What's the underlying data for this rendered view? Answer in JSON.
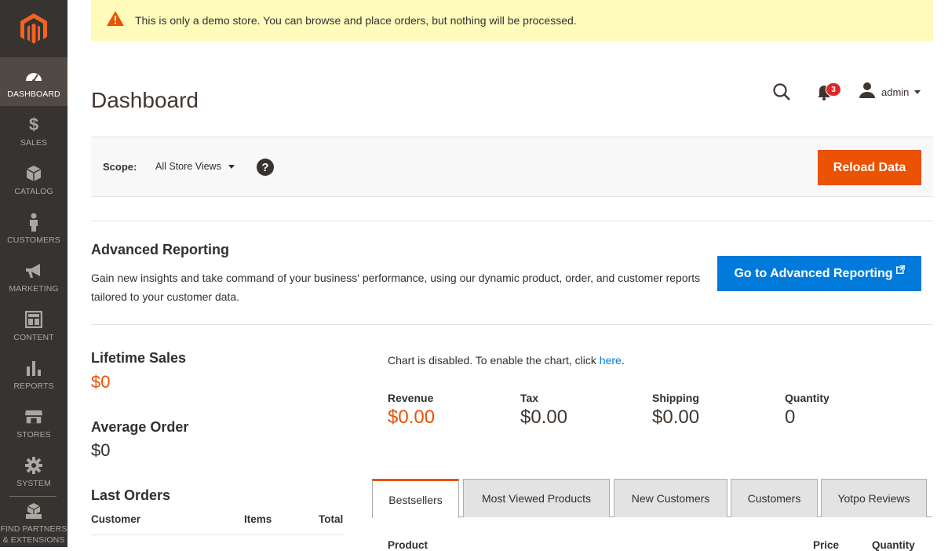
{
  "notice": {
    "text": "This is only a demo store. You can browse and place orders, but nothing will be processed."
  },
  "sidebar": {
    "items": [
      {
        "label": "DASHBOARD",
        "icon": "dashboard-icon",
        "active": true
      },
      {
        "label": "SALES",
        "icon": "dollar-icon"
      },
      {
        "label": "CATALOG",
        "icon": "box-icon"
      },
      {
        "label": "CUSTOMERS",
        "icon": "person-icon"
      },
      {
        "label": "MARKETING",
        "icon": "megaphone-icon"
      },
      {
        "label": "CONTENT",
        "icon": "layout-icon"
      },
      {
        "label": "REPORTS",
        "icon": "bar-chart-icon"
      },
      {
        "label": "STORES",
        "icon": "store-icon"
      },
      {
        "label": "SYSTEM",
        "icon": "gear-icon"
      },
      {
        "label_line1": "FIND PARTNERS",
        "label_line2": "& EXTENSIONS",
        "icon": "cubes-icon"
      }
    ]
  },
  "header": {
    "title": "Dashboard",
    "notifications_count": "3",
    "user_name": "admin"
  },
  "scope": {
    "label": "Scope:",
    "selected": "All Store Views",
    "help": "?",
    "reload_label": "Reload Data"
  },
  "advanced_reporting": {
    "title": "Advanced Reporting",
    "description": "Gain new insights and take command of your business' performance, using our dynamic product, order, and customer reports tailored to your customer data.",
    "button_label": "Go to Advanced Reporting"
  },
  "stats": {
    "lifetime_sales_label": "Lifetime Sales",
    "lifetime_sales_value": "$0",
    "average_order_label": "Average Order",
    "average_order_value": "$0",
    "last_orders_label": "Last Orders",
    "last_orders_columns": [
      "Customer",
      "Items",
      "Total"
    ]
  },
  "chart": {
    "message_prefix": "Chart is disabled. To enable the chart, click ",
    "link_text": "here",
    "message_suffix": "."
  },
  "totals": [
    {
      "label": "Revenue",
      "value": "$0.00"
    },
    {
      "label": "Tax",
      "value": "$0.00"
    },
    {
      "label": "Shipping",
      "value": "$0.00"
    },
    {
      "label": "Quantity",
      "value": "0"
    }
  ],
  "tabs": [
    "Bestsellers",
    "Most Viewed Products",
    "New Customers",
    "Customers",
    "Yotpo Reviews"
  ],
  "grid_columns": [
    "Product",
    "Price",
    "Quantity"
  ],
  "colors": {
    "accent": "#eb5202",
    "link": "#007bdb",
    "sidebar": "#373330",
    "notice": "#fffbbb"
  }
}
